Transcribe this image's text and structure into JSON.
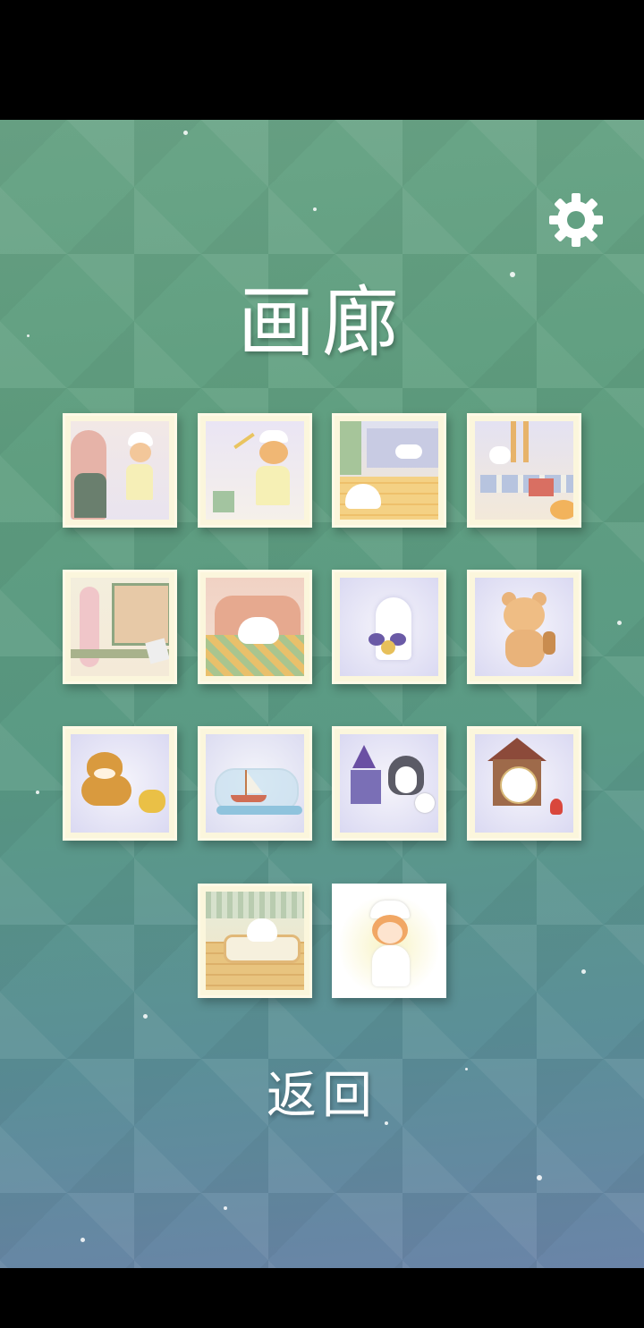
{
  "title": "画廊",
  "back_label": "返回",
  "settings": {
    "icon": "gear-icon"
  },
  "gallery": [
    {
      "id": "girl-with-mirror"
    },
    {
      "id": "girl-with-cat-toy"
    },
    {
      "id": "cat-on-windowsill"
    },
    {
      "id": "cats-with-gifts"
    },
    {
      "id": "pink-cat-at-window"
    },
    {
      "id": "cat-on-armchair"
    },
    {
      "id": "ghost-cat-with-bell"
    },
    {
      "id": "teddy-bear-with-cookie"
    },
    {
      "id": "shiba-dog-with-toy"
    },
    {
      "id": "ship-in-bottle"
    },
    {
      "id": "penguin-and-snowman"
    },
    {
      "id": "cuckoo-clock"
    },
    {
      "id": "cat-in-bed"
    },
    {
      "id": "girl-in-white"
    }
  ],
  "colors": {
    "accent": "#ffffff",
    "tile_frame": "#fbf6dc"
  }
}
